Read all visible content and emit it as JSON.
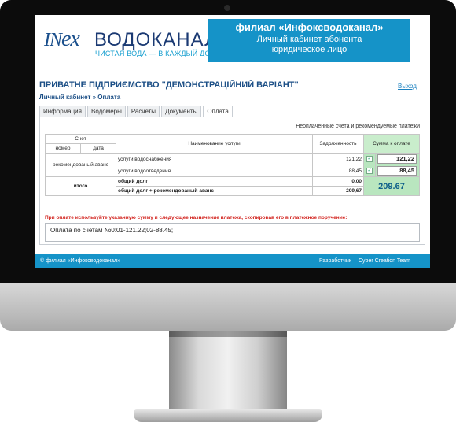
{
  "header": {
    "logo_mark": "IN",
    "logo_x": "ex",
    "logo_name": "ВОДОКАНАЛ",
    "logo_tagline": "ЧИСТАЯ ВОДА — В КАЖДЫЙ ДОМ",
    "branch_title": "филиал «Инфоксводоканал»",
    "branch_line2": "Личный кабинет абонента",
    "branch_line3": "юридическое лицо"
  },
  "page": {
    "company_title": "ПРИВАТНЕ ПІДПРИЄМСТВО \"ДЕМОНСТРАЦІЙНИЙ ВАРІАНТ\"",
    "logout_label": "Выход",
    "breadcrumb": "Личный кабинет » Оплата"
  },
  "tabs": [
    {
      "label": "Информация",
      "active": false
    },
    {
      "label": "Водомеры",
      "active": false
    },
    {
      "label": "Расчеты",
      "active": false
    },
    {
      "label": "Документы",
      "active": false
    },
    {
      "label": "Оплата",
      "active": true
    }
  ],
  "payment": {
    "unpaid_title": "Неоплаченные счета и рекомендуемые платежи",
    "col_account": "Счет",
    "col_number": "номер",
    "col_date": "дата",
    "col_service": "Наименование услуги",
    "col_debt": "Задолженность",
    "col_pay": "Сумма к оплате",
    "account_label": "рекомендованый аванс",
    "rows": [
      {
        "service": "услуги водоснабжения",
        "debt": "121,22",
        "pay": "121,22"
      },
      {
        "service": "услуги водоотведения",
        "debt": "88,45",
        "pay": "88,45"
      }
    ],
    "total_label": "итого",
    "total_debt_label": "общий долг",
    "total_debt_value": "0,00",
    "total_adv_label": "общий долг + рекомендованый аванс",
    "total_adv_value": "209,67",
    "grand_total": "209.67",
    "notice": "При оплате используйте указанную сумму и следующее назначение платежа, скопировав его в платежное поручение:",
    "purpose": "Оплата по счетам №0:01-121.22;02-88.45;"
  },
  "footer": {
    "copyright": "© филиал «Инфоксводоканал»",
    "developer_label": "Разработчик",
    "developer_name": "Cyber Creation Team"
  }
}
